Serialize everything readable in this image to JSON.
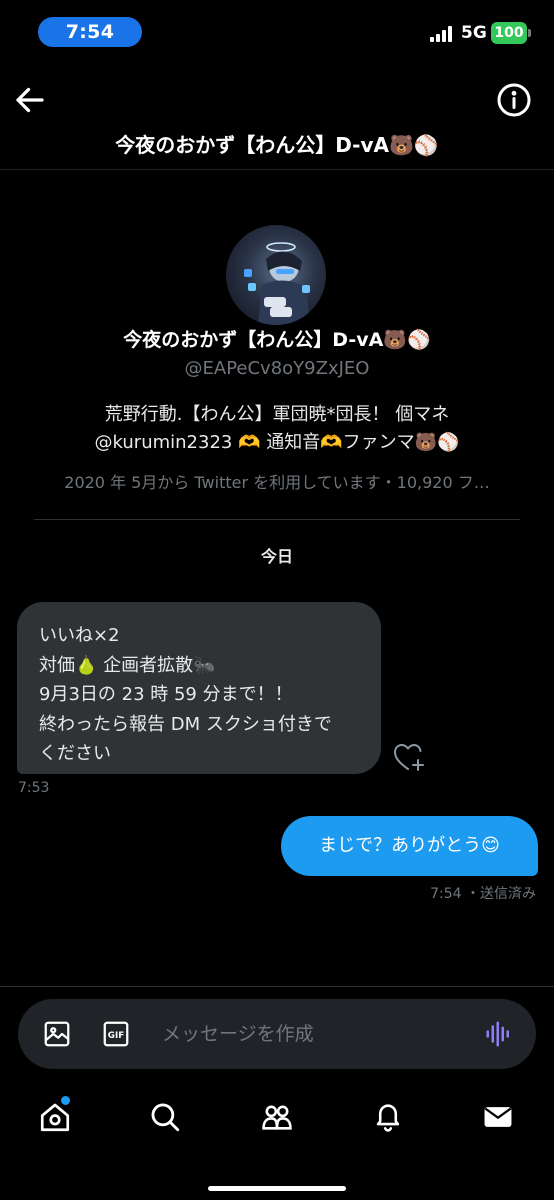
{
  "status_bar": {
    "time": "7:54",
    "network": "5G",
    "battery": "100",
    "accent_color": "#1a74e8",
    "battery_color": "#34c759"
  },
  "header": {
    "title": "今夜のおかず【わん公】D-vA🐻⚾",
    "back_icon": "arrow-left-icon",
    "info_icon": "info-icon"
  },
  "profile": {
    "avatar_icon": "avatar-image",
    "name": "今夜のおかず【わん公】D-vA🐻⚾",
    "handle": "@EAPeCv8oY9ZxJEO",
    "bio": "荒野行動.【わん公】軍団暁*団長！ 個マネ @kurumin2323 🫶 通知音🫶ファンマ🐻⚾",
    "meta": "2020 年 5月から Twitter を利用しています・10,920 フ…"
  },
  "conversation": {
    "day_label": "今日",
    "received_message": {
      "lines": [
        "いいね×2",
        "対価🍐 企画者拡散🐜",
        "9月3日の 23 時 59 分まで！！",
        "終わったら報告 DM スクショ付きで",
        "ください"
      ],
      "time": "7:53",
      "react_icon": "heart-plus-icon"
    },
    "sent_message": {
      "text": "まじで？ありがとう😊",
      "status": "7:54 ・送信済み"
    }
  },
  "composer": {
    "placeholder": "メッセージを作成",
    "image_icon": "image-icon",
    "gif_icon": "gif-icon",
    "gif_label": "GIF",
    "voice_icon": "voice-waveform-icon"
  },
  "tab_bar": {
    "items": [
      "home-icon",
      "search-icon",
      "communities-icon",
      "notifications-icon",
      "messages-icon"
    ]
  },
  "colors": {
    "background": "#000000",
    "sent_bubble": "#1d9bf0",
    "received_bubble": "#2f3336",
    "muted_text": "#71767b"
  }
}
